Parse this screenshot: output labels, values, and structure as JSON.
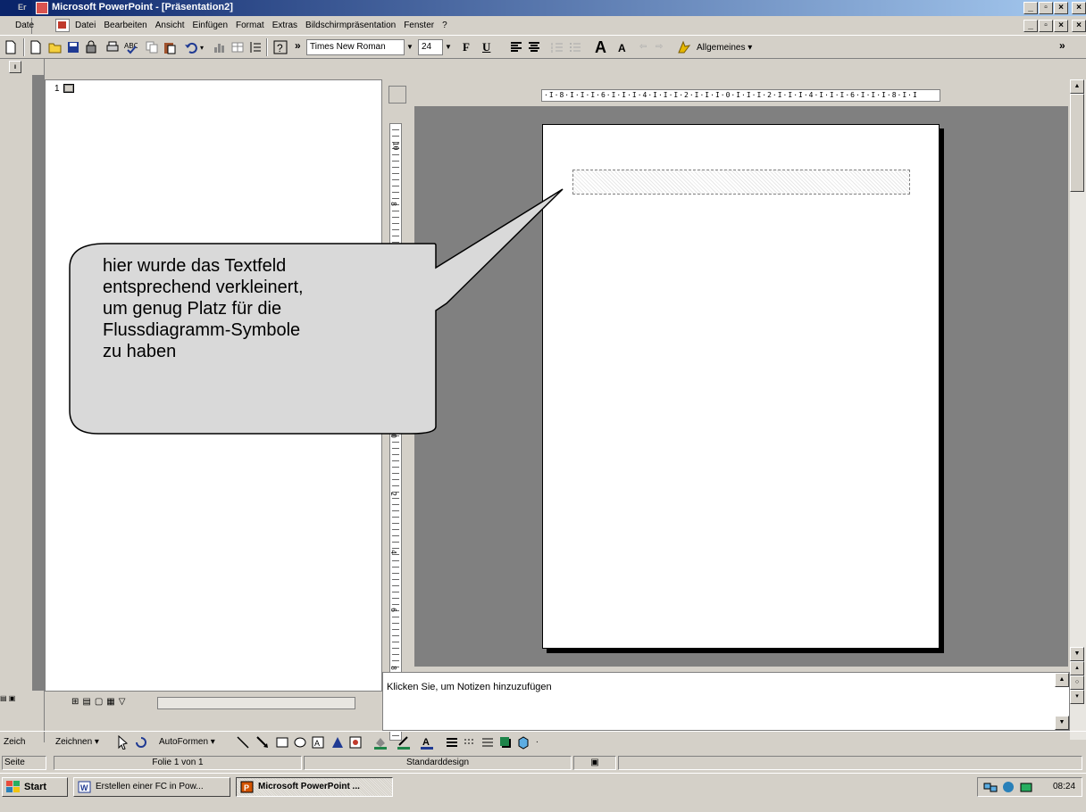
{
  "titlebar": {
    "outer_stub": "Er",
    "title": "Microsoft PowerPoint - [Präsentation2]"
  },
  "menubar": {
    "outer_stub": "Date",
    "items": [
      "Datei",
      "Bearbeiten",
      "Ansicht",
      "Einfügen",
      "Format",
      "Extras",
      "Bildschirmpräsentation",
      "Fenster",
      "?"
    ]
  },
  "toolbar": {
    "font_name": "Times New Roman",
    "font_size": "24",
    "bold_label": "F",
    "underline_label": "U",
    "design_label": "Allgemeines ▾",
    "overflow_label": "»"
  },
  "outline": {
    "slide_number": "1"
  },
  "ruler": {
    "h_text": "·I·8·I·I·I·6·I·I·I·4·I·I·I·2·I·I·I·0·I·I·I·2·I·I·I·4·I·I·I·6·I·I·I·8·I·I",
    "v_labels": [
      "10",
      "8",
      "6",
      "4",
      "2",
      "0",
      "2",
      "4",
      "6",
      "8",
      "10"
    ]
  },
  "callout": {
    "text": "hier wurde das Textfeld\nentsprechend verkleinert,\num genug Platz für die\nFlussdiagramm-Symbole\nzu haben"
  },
  "notes": {
    "placeholder": "Klicken Sie, um Notizen hinzuzufügen"
  },
  "drawbar": {
    "outer_stub": "Zeich",
    "draw_label": "Zeichnen ▾",
    "autoshapes_label": "AutoFormen ▾"
  },
  "statusbar": {
    "outer_stub": "Seite",
    "slide_info": "Folie 1 von 1",
    "design": "Standarddesign"
  },
  "taskbar": {
    "start_label": "Start",
    "task1": "Erstellen einer FC in Pow...",
    "task2": "Microsoft PowerPoint ...",
    "clock": "08:24"
  },
  "colors": {
    "title_bar_start": "#0a246a",
    "title_bar_end": "#a6caf0",
    "window_face": "#d4d0c8",
    "slide_area": "#808080",
    "callout_fill": "#d9d9d9"
  }
}
